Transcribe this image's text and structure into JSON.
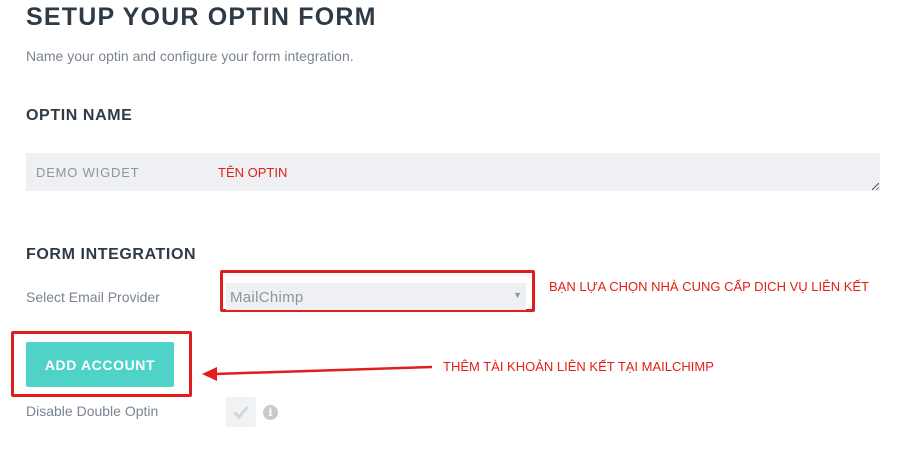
{
  "header": {
    "title": "SETUP YOUR OPTIN FORM",
    "subtitle": "Name your optin and configure your form integration."
  },
  "optin_name": {
    "heading": "OPTIN NAME",
    "value": "DEMO WIGDET",
    "annotation": "TÊN OPTIN"
  },
  "form_integration": {
    "heading": "FORM INTEGRATION",
    "provider_label": "Select Email Provider",
    "provider_selected": "MailChimp",
    "provider_annotation": "BẠN LỰA CHỌN NHÀ CUNG CẤP DỊCH VỤ LIÊN KẾT",
    "add_account_label": "ADD ACCOUNT",
    "add_account_annotation": "THÊM TÀI KHOẢN LIÊN KẾT TẠI MAILCHIMP",
    "double_optin_label": "Disable Double Optin",
    "info_glyph": "i"
  },
  "colors": {
    "accent": "#4fd2c8",
    "annotation_red": "#e01e1e",
    "field_bg": "#eef0f3"
  }
}
